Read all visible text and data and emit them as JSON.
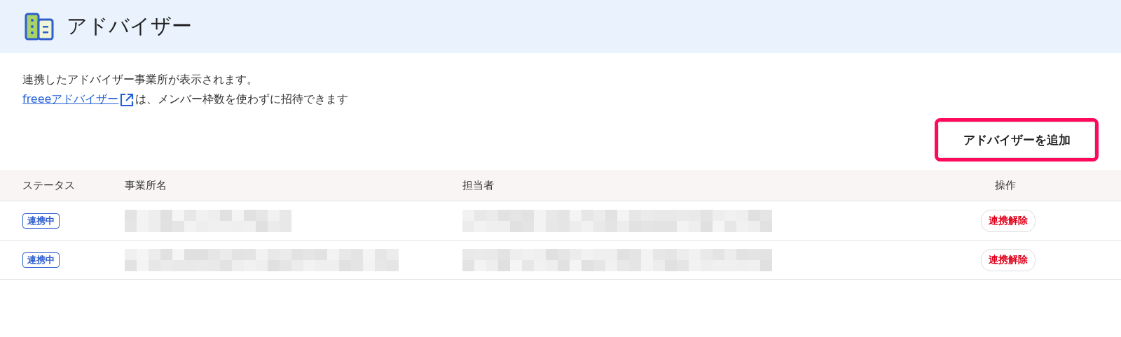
{
  "header": {
    "title": "アドバイザー"
  },
  "description": {
    "line": "連携したアドバイザー事業所が表示されます。",
    "link": "freeeアドバイザー",
    "link_suffix": "は、メンバー枠数を使わずに招待できます"
  },
  "add_button": {
    "label": "アドバイザーを追加",
    "highlighted": true
  },
  "table": {
    "columns": [
      "ステータス",
      "事業所名",
      "担当者",
      "操作"
    ],
    "rows": [
      {
        "status": "連携中",
        "office": {
          "kind": "redacted"
        },
        "person": {
          "kind": "redacted"
        },
        "action": "連携解除"
      },
      {
        "status": "連携中",
        "office": {
          "kind": "redacted"
        },
        "person": {
          "kind": "redacted"
        },
        "action": "連携解除"
      }
    ]
  }
}
